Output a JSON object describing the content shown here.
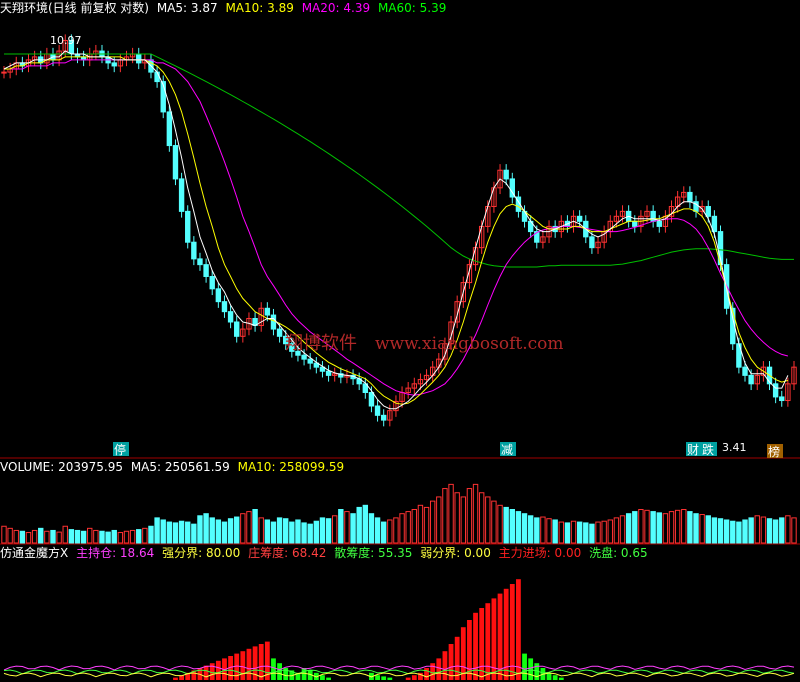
{
  "main_legend": {
    "title": "天翔环境(日线 前复权 对数)",
    "ma5_label": "MA5: 3.87",
    "ma10_label": "MA10: 3.89",
    "ma20_label": "MA20: 4.39",
    "ma60_label": "MA60: 5.39"
  },
  "volume_legend": {
    "title": "VOLUME: 203975.95",
    "ma5_label": "MA5: 250561.59",
    "ma10_label": "MA10: 258099.59"
  },
  "indicator_legend": {
    "title": "仿通金魔方X",
    "items": [
      {
        "label": "主持仓: 18.64",
        "color": "#ff40ff"
      },
      {
        "label": "强分界: 80.00",
        "color": "#ffff40"
      },
      {
        "label": "庄筹度: 68.42",
        "color": "#ff4040"
      },
      {
        "label": "散筹度: 55.35",
        "color": "#40ff40"
      },
      {
        "label": "弱分界: 0.00",
        "color": "#ffff40"
      },
      {
        "label": "主力进场: 0.00",
        "color": "#ff2020"
      },
      {
        "label": "洗盘: 0.65",
        "color": "#40ff40"
      }
    ]
  },
  "annotations": {
    "high_label": "10.97",
    "low_label": "3.41",
    "marker_stop": "停",
    "marker_reduce": "减",
    "marker_finance": "财",
    "marker_fall": "跌",
    "marker_list": "榜",
    "watermark_cn": "翔博软件",
    "watermark_url": "www.xiangbosoft.com"
  },
  "colors": {
    "up": "#ff3232",
    "down": "#54ffff",
    "ma5": "#ffffff",
    "ma10": "#ffff00",
    "ma20": "#ff00ff",
    "ma60": "#00c000",
    "text_white": "#ffffff",
    "text_yellow": "#ffff00",
    "text_magenta": "#ff00ff",
    "text_green": "#00ff00"
  },
  "chart_data": {
    "type": "candlestick",
    "price": {
      "scale": "log",
      "ylim": [
        3.0,
        11.8
      ],
      "close": [
        9.9,
        10.0,
        10.2,
        10.1,
        10.3,
        10.4,
        10.2,
        10.5,
        10.3,
        10.6,
        10.97,
        10.5,
        10.4,
        10.3,
        10.5,
        10.6,
        10.4,
        10.2,
        10.1,
        10.3,
        10.4,
        10.5,
        10.2,
        10.3,
        9.9,
        9.6,
        8.7,
        7.8,
        7.0,
        6.3,
        5.7,
        5.4,
        5.3,
        5.1,
        4.9,
        4.7,
        4.55,
        4.4,
        4.2,
        4.3,
        4.45,
        4.35,
        4.6,
        4.5,
        4.3,
        4.2,
        4.1,
        4.0,
        3.95,
        3.9,
        3.85,
        3.8,
        3.75,
        3.7,
        3.72,
        3.68,
        3.7,
        3.66,
        3.6,
        3.5,
        3.35,
        3.25,
        3.2,
        3.3,
        3.4,
        3.5,
        3.55,
        3.6,
        3.65,
        3.7,
        3.8,
        3.9,
        4.1,
        4.4,
        4.7,
        5.0,
        5.3,
        5.6,
        6.0,
        6.4,
        6.8,
        7.2,
        7.0,
        6.6,
        6.3,
        6.1,
        5.9,
        5.7,
        5.8,
        6.0,
        5.9,
        6.1,
        6.0,
        6.2,
        6.1,
        5.8,
        5.6,
        5.7,
        5.9,
        6.1,
        6.2,
        6.3,
        6.1,
        6.0,
        6.2,
        6.3,
        6.1,
        6.0,
        6.2,
        6.4,
        6.6,
        6.7,
        6.5,
        6.3,
        6.4,
        6.2,
        5.9,
        5.3,
        4.6,
        4.1,
        3.8,
        3.7,
        3.6,
        3.7,
        3.8,
        3.6,
        3.45,
        3.41,
        3.6,
        3.8
      ],
      "ma5": [
        10.0,
        10.1,
        10.2,
        10.2,
        10.2,
        10.3,
        10.3,
        10.3,
        10.4,
        10.4,
        10.6,
        10.5,
        10.5,
        10.5,
        10.4,
        10.4,
        10.4,
        10.4,
        10.3,
        10.3,
        10.3,
        10.3,
        10.3,
        10.3,
        10.1,
        9.9,
        9.5,
        8.9,
        8.2,
        7.5,
        6.8,
        6.3,
        5.8,
        5.5,
        5.2,
        5.0,
        4.85,
        4.65,
        4.5,
        4.4,
        4.38,
        4.35,
        4.4,
        4.45,
        4.45,
        4.35,
        4.25,
        4.15,
        4.05,
        3.98,
        3.92,
        3.86,
        3.81,
        3.76,
        3.73,
        3.71,
        3.7,
        3.69,
        3.66,
        3.61,
        3.52,
        3.42,
        3.35,
        3.32,
        3.32,
        3.36,
        3.4,
        3.47,
        3.55,
        3.62,
        3.7,
        3.8,
        3.95,
        4.2,
        4.5,
        4.85,
        5.2,
        5.6,
        6.0,
        6.4,
        6.8,
        7.0,
        6.9,
        6.7,
        6.5,
        6.3,
        6.1,
        5.95,
        5.9,
        5.9,
        5.95,
        6.0,
        6.05,
        6.1,
        6.05,
        5.95,
        5.85,
        5.8,
        5.85,
        5.95,
        6.05,
        6.15,
        6.2,
        6.15,
        6.15,
        6.15,
        6.15,
        6.12,
        6.15,
        6.25,
        6.4,
        6.5,
        6.5,
        6.45,
        6.35,
        6.15,
        5.85,
        5.4,
        4.9,
        4.45,
        4.1,
        3.85,
        3.72,
        3.72,
        3.72,
        3.62,
        3.55,
        3.55,
        3.7
      ],
      "ma10": [
        10.0,
        10.0,
        10.1,
        10.1,
        10.2,
        10.2,
        10.2,
        10.3,
        10.3,
        10.3,
        10.4,
        10.4,
        10.4,
        10.4,
        10.4,
        10.4,
        10.4,
        10.4,
        10.4,
        10.4,
        10.3,
        10.3,
        10.3,
        10.3,
        10.2,
        10.1,
        9.9,
        9.6,
        9.2,
        8.7,
        8.1,
        7.5,
        6.9,
        6.4,
        6.0,
        5.6,
        5.3,
        5.1,
        4.9,
        4.75,
        4.65,
        4.55,
        4.5,
        4.45,
        4.42,
        4.38,
        4.33,
        4.27,
        4.2,
        4.12,
        4.05,
        3.98,
        3.92,
        3.86,
        3.82,
        3.78,
        3.75,
        3.72,
        3.69,
        3.66,
        3.6,
        3.52,
        3.46,
        3.42,
        3.38,
        3.37,
        3.38,
        3.42,
        3.48,
        3.55,
        3.62,
        3.7,
        3.8,
        3.95,
        4.15,
        4.4,
        4.7,
        5.0,
        5.35,
        5.7,
        6.0,
        6.25,
        6.4,
        6.45,
        6.4,
        6.3,
        6.2,
        6.1,
        6.0,
        5.95,
        5.95,
        5.95,
        5.95,
        6.0,
        6.0,
        5.95,
        5.9,
        5.9,
        5.9,
        5.95,
        6.0,
        6.05,
        6.1,
        6.1,
        6.1,
        6.12,
        6.15,
        6.15,
        6.2,
        6.25,
        6.3,
        6.35,
        6.35,
        6.3,
        6.2,
        6.0,
        5.7,
        5.3,
        4.9,
        4.55,
        4.25,
        4.05,
        3.9,
        3.8,
        3.75,
        3.7,
        3.65,
        3.62,
        3.64
      ],
      "ma20": [
        10.0,
        10.0,
        10.0,
        10.0,
        10.1,
        10.1,
        10.1,
        10.1,
        10.2,
        10.2,
        10.2,
        10.3,
        10.3,
        10.3,
        10.3,
        10.3,
        10.3,
        10.3,
        10.3,
        10.3,
        10.3,
        10.3,
        10.3,
        10.3,
        10.3,
        10.2,
        10.2,
        10.1,
        10.0,
        9.8,
        9.6,
        9.3,
        9.0,
        8.6,
        8.2,
        7.8,
        7.4,
        7.0,
        6.6,
        6.2,
        5.9,
        5.6,
        5.3,
        5.1,
        4.95,
        4.8,
        4.65,
        4.52,
        4.42,
        4.34,
        4.26,
        4.2,
        4.14,
        4.08,
        4.02,
        3.96,
        3.9,
        3.85,
        3.8,
        3.75,
        3.7,
        3.65,
        3.6,
        3.56,
        3.52,
        3.5,
        3.48,
        3.47,
        3.48,
        3.5,
        3.52,
        3.56,
        3.6,
        3.68,
        3.78,
        3.9,
        4.05,
        4.22,
        4.42,
        4.65,
        4.88,
        5.1,
        5.3,
        5.45,
        5.58,
        5.7,
        5.8,
        5.88,
        5.93,
        5.96,
        5.98,
        6.0,
        6.0,
        6.0,
        5.98,
        5.96,
        5.94,
        5.92,
        5.9,
        5.9,
        5.9,
        5.92,
        5.95,
        5.98,
        6.02,
        6.06,
        6.1,
        6.12,
        6.14,
        6.15,
        6.15,
        6.12,
        6.05,
        5.95,
        5.8,
        5.6,
        5.38,
        5.15,
        4.95,
        4.75,
        4.58,
        4.42,
        4.3,
        4.2,
        4.12,
        4.05,
        4.0,
        3.96,
        3.94
      ],
      "ma60": [
        10.5,
        10.5,
        10.5,
        10.5,
        10.5,
        10.5,
        10.5,
        10.5,
        10.5,
        10.5,
        10.5,
        10.5,
        10.5,
        10.5,
        10.5,
        10.5,
        10.5,
        10.5,
        10.5,
        10.5,
        10.5,
        10.5,
        10.5,
        10.5,
        10.5,
        10.4,
        10.3,
        10.2,
        10.1,
        10.0,
        9.9,
        9.8,
        9.7,
        9.6,
        9.5,
        9.4,
        9.3,
        9.2,
        9.1,
        9.0,
        8.9,
        8.8,
        8.7,
        8.6,
        8.5,
        8.4,
        8.3,
        8.2,
        8.1,
        8.0,
        7.9,
        7.8,
        7.7,
        7.6,
        7.5,
        7.4,
        7.3,
        7.2,
        7.1,
        7.0,
        6.9,
        6.8,
        6.7,
        6.6,
        6.5,
        6.4,
        6.3,
        6.2,
        6.1,
        6.0,
        5.9,
        5.8,
        5.7,
        5.6,
        5.52,
        5.45,
        5.4,
        5.36,
        5.33,
        5.3,
        5.28,
        5.27,
        5.26,
        5.26,
        5.26,
        5.26,
        5.26,
        5.26,
        5.27,
        5.28,
        5.28,
        5.29,
        5.29,
        5.29,
        5.29,
        5.29,
        5.29,
        5.29,
        5.29,
        5.29,
        5.3,
        5.31,
        5.33,
        5.35,
        5.37,
        5.4,
        5.43,
        5.46,
        5.49,
        5.52,
        5.54,
        5.56,
        5.57,
        5.58,
        5.58,
        5.58,
        5.57,
        5.56,
        5.55,
        5.53,
        5.51,
        5.49,
        5.47,
        5.45,
        5.43,
        5.41,
        5.4,
        5.39,
        5.39,
        5.39
      ]
    },
    "volume": {
      "values": [
        40,
        35,
        30,
        28,
        25,
        30,
        35,
        28,
        30,
        26,
        40,
        32,
        30,
        28,
        35,
        30,
        28,
        26,
        30,
        25,
        28,
        30,
        32,
        35,
        40,
        60,
        55,
        50,
        48,
        52,
        50,
        45,
        65,
        70,
        60,
        55,
        50,
        58,
        62,
        70,
        75,
        80,
        60,
        55,
        50,
        60,
        58,
        50,
        55,
        48,
        45,
        52,
        60,
        58,
        65,
        80,
        75,
        70,
        85,
        90,
        70,
        60,
        50,
        55,
        60,
        70,
        75,
        80,
        90,
        85,
        100,
        110,
        130,
        140,
        120,
        110,
        130,
        140,
        120,
        110,
        100,
        90,
        85,
        80,
        75,
        70,
        65,
        60,
        62,
        58,
        55,
        50,
        48,
        52,
        50,
        48,
        45,
        50,
        52,
        55,
        60,
        65,
        70,
        75,
        80,
        78,
        75,
        72,
        70,
        75,
        78,
        80,
        75,
        70,
        68,
        65,
        60,
        58,
        55,
        52,
        50,
        55,
        60,
        65,
        62,
        58,
        55,
        60,
        65,
        60
      ],
      "ylim": [
        0,
        160
      ]
    },
    "indicator": {
      "series_red": [
        0,
        0,
        0,
        0,
        0,
        0,
        0,
        0,
        0,
        0,
        0,
        0,
        0,
        0,
        0,
        0,
        0,
        0,
        0,
        0,
        0,
        0,
        0,
        0,
        0,
        0,
        0,
        0,
        2,
        4,
        6,
        8,
        10,
        12,
        14,
        16,
        18,
        20,
        22,
        24,
        26,
        28,
        30,
        32,
        0,
        0,
        0,
        0,
        0,
        0,
        0,
        0,
        0,
        0,
        0,
        0,
        0,
        0,
        0,
        0,
        0,
        0,
        0,
        0,
        0,
        0,
        2,
        4,
        6,
        10,
        14,
        18,
        24,
        30,
        36,
        44,
        50,
        56,
        60,
        64,
        68,
        72,
        76,
        80,
        84,
        0,
        0,
        0,
        0,
        0,
        0,
        0,
        0,
        0,
        0,
        0,
        0,
        0,
        0,
        0,
        0,
        0,
        0,
        0,
        0,
        0,
        0,
        0,
        0,
        0,
        0,
        0,
        0,
        0,
        0,
        0,
        0,
        0,
        0,
        0,
        0,
        0,
        0,
        0,
        0,
        0,
        0,
        0,
        0,
        0
      ],
      "series_green": [
        0,
        0,
        0,
        0,
        0,
        0,
        0,
        0,
        0,
        0,
        0,
        0,
        0,
        0,
        0,
        0,
        0,
        0,
        0,
        0,
        0,
        0,
        0,
        0,
        0,
        0,
        0,
        0,
        0,
        0,
        0,
        0,
        0,
        0,
        0,
        0,
        0,
        0,
        0,
        0,
        0,
        0,
        0,
        0,
        18,
        14,
        10,
        8,
        6,
        10,
        8,
        6,
        4,
        2,
        0,
        0,
        0,
        0,
        0,
        0,
        6,
        4,
        3,
        2,
        0,
        0,
        0,
        0,
        0,
        0,
        0,
        0,
        0,
        0,
        0,
        0,
        0,
        0,
        0,
        0,
        0,
        0,
        0,
        0,
        0,
        22,
        18,
        14,
        10,
        6,
        4,
        2,
        0,
        0,
        0,
        0,
        0,
        0,
        0,
        0,
        0,
        0,
        0,
        0,
        0,
        0,
        0,
        0,
        0,
        0,
        0,
        0,
        0,
        0,
        0,
        0,
        0,
        0,
        0,
        0,
        0,
        0,
        0,
        0,
        0,
        0,
        0,
        0,
        0,
        0
      ],
      "ylim": [
        0,
        100
      ]
    }
  }
}
